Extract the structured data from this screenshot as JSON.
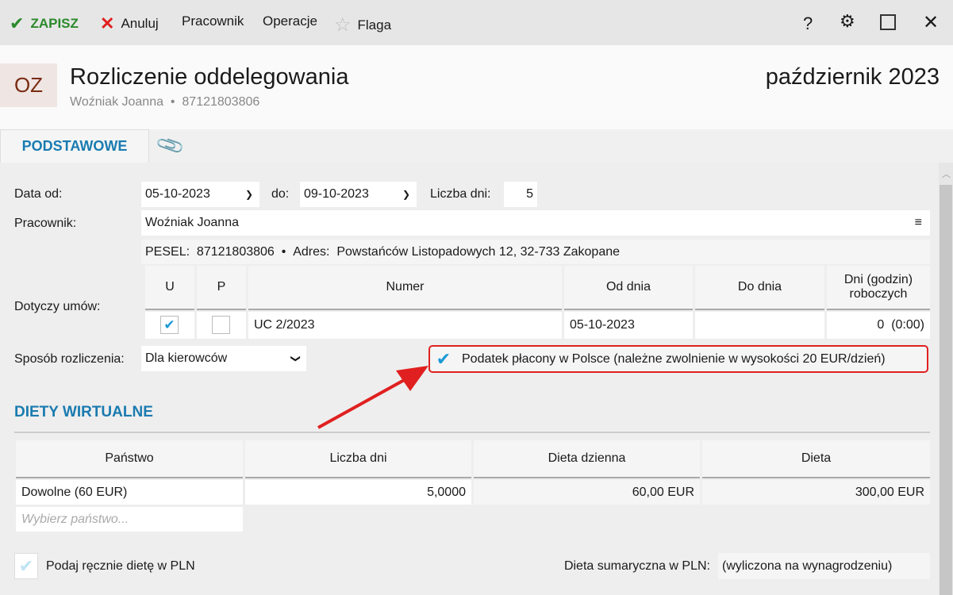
{
  "toolbar": {
    "save": "ZAPISZ",
    "cancel": "Anuluj",
    "employee": "Pracownik",
    "operations": "Operacje",
    "flag": "Flaga"
  },
  "header": {
    "badge": "OZ",
    "title": "Rozliczenie oddelegowania",
    "employee": "Woźniak Joanna",
    "pesel": "87121803806",
    "period": "październik 2023"
  },
  "tabs": {
    "basic": "PODSTAWOWE"
  },
  "form": {
    "date_from_label": "Data od:",
    "date_from": "05-10-2023",
    "to_label": "do:",
    "date_to": "09-10-2023",
    "days_label": "Liczba dni:",
    "days": "5",
    "employee_label": "Pracownik:",
    "employee": "Woźniak Joanna",
    "pesel_label": "PESEL:",
    "pesel": "87121803806",
    "address_label": "Adres:",
    "address": "Powstańców Listopadowych 12, 32-733 Zakopane",
    "contracts_label": "Dotyczy umów:",
    "contracts_headers": [
      "U",
      "P",
      "Numer",
      "Od dnia",
      "Do dnia",
      "Dni (godzin) roboczych"
    ],
    "contracts_rows": [
      {
        "u": true,
        "p": false,
        "number": "UC 2/2023",
        "from": "05-10-2023",
        "to": "",
        "days": "0  (0:00)"
      }
    ],
    "method_label": "Sposób rozliczenia:",
    "method": "Dla kierowców",
    "tax_checkbox": "Podatek płacony w Polsce (należne zwolnienie w wysokości 20 EUR/dzień)",
    "tax_checked": true
  },
  "diets": {
    "heading": "DIETY WIRTUALNE",
    "headers": [
      "Państwo",
      "Liczba dni",
      "Dieta dzienna",
      "Dieta"
    ],
    "rows": [
      {
        "country": "Dowolne (60 EUR)",
        "days": "5,0000",
        "daily": "60,00 EUR",
        "total": "300,00 EUR"
      }
    ],
    "country_placeholder": "Wybierz państwo...",
    "manual_label": "Podaj ręcznie dietę w PLN",
    "sum_label": "Dieta sumaryczna w PLN:",
    "sum_value": "(wyliczona na wynagrodzeniu)"
  },
  "colors": {
    "accent": "#1a7bb0",
    "save": "#2a8a2a",
    "highlight": "#e02020"
  }
}
